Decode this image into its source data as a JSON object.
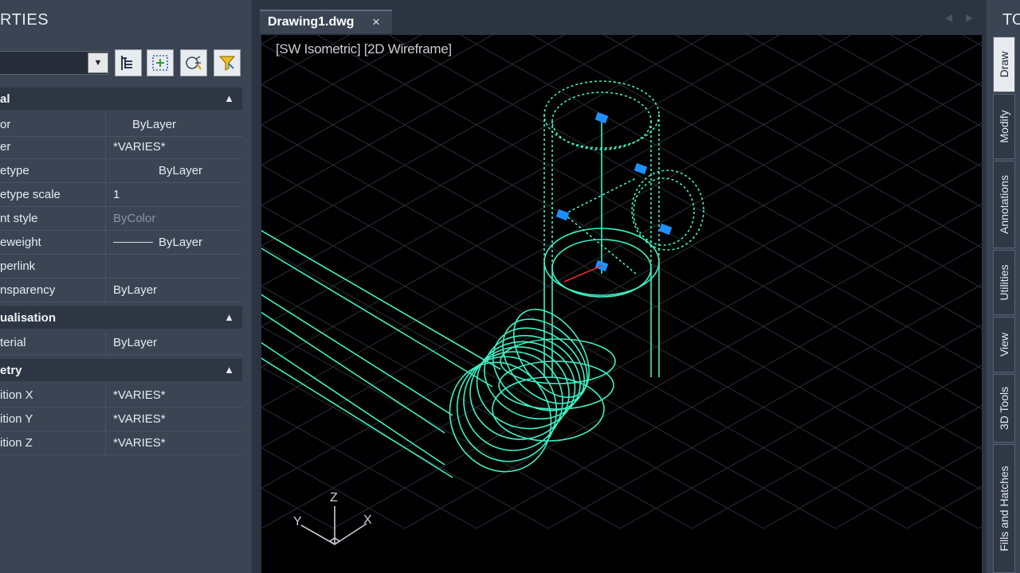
{
  "properties": {
    "title": "RTIES",
    "toolbar_icons": [
      "toggle-pickadd-icon",
      "select-objects-icon",
      "quick-select-icon",
      "filter-icon"
    ],
    "sections": [
      {
        "label": "al"
      },
      {
        "label": "ualisation"
      },
      {
        "label": "etry"
      }
    ],
    "general": [
      {
        "key": "or",
        "value": "ByLayer"
      },
      {
        "key": "er",
        "value": "*VARIES*"
      },
      {
        "key": "etype",
        "value": "ByLayer"
      },
      {
        "key": "etype scale",
        "value": "1"
      },
      {
        "key": "nt style",
        "value": "ByColor"
      },
      {
        "key": "eweight",
        "value": "ByLayer"
      },
      {
        "key": "perlink",
        "value": ""
      },
      {
        "key": "nsparency",
        "value": "ByLayer"
      }
    ],
    "visualisation": [
      {
        "key": "terial",
        "value": "ByLayer"
      }
    ],
    "geometry": [
      {
        "key": "ition X",
        "value": "*VARIES*"
      },
      {
        "key": "ition Y",
        "value": "*VARIES*"
      },
      {
        "key": "ition Z",
        "value": "*VARIES*"
      }
    ]
  },
  "tab": {
    "name": "Drawing1.dwg",
    "close": "×"
  },
  "viewport": {
    "label": "[SW Isometric] [2D Wireframe]",
    "ucs": {
      "x": "X",
      "y": "Y",
      "z": "Z"
    }
  },
  "tools": {
    "title": "TO",
    "tabs": [
      "Draw",
      "Modify",
      "Annotations",
      "Utilities",
      "View",
      "3D Tools",
      "Fills and Hatches"
    ]
  },
  "colors": {
    "wireframe": "#3ef0c4",
    "grips": "#1e90ff",
    "grid": "#2a2f36"
  }
}
